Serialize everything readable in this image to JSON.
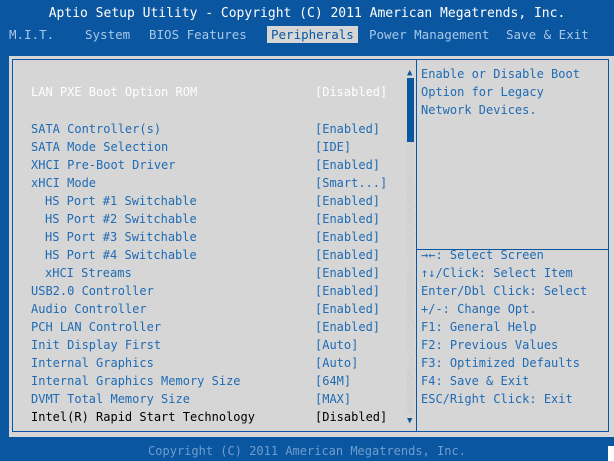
{
  "header": {
    "title": "Aptio Setup Utility - Copyright (C) 2011 American Megatrends, Inc."
  },
  "tabs": [
    {
      "label": "M.I.T."
    },
    {
      "label": "System"
    },
    {
      "label": "BIOS Features"
    },
    {
      "label": "Peripherals",
      "active": true
    },
    {
      "label": "Power Management"
    },
    {
      "label": "Save & Exit"
    }
  ],
  "settings": [
    {
      "label": "LAN PXE Boot Option ROM",
      "value": "[Disabled]"
    },
    {
      "label": "SATA Controller(s)",
      "value": "[Enabled]"
    },
    {
      "label": "SATA Mode Selection",
      "value": "[IDE]"
    },
    {
      "label": "XHCI Pre-Boot Driver",
      "value": "[Enabled]"
    },
    {
      "label": "xHCI Mode",
      "value": "[Smart...]"
    },
    {
      "label": "HS Port #1 Switchable",
      "value": "[Enabled]"
    },
    {
      "label": "HS Port #2 Switchable",
      "value": "[Enabled]"
    },
    {
      "label": "HS Port #3 Switchable",
      "value": "[Enabled]"
    },
    {
      "label": "HS Port #4 Switchable",
      "value": "[Enabled]"
    },
    {
      "label": "xHCI Streams",
      "value": "[Enabled]"
    },
    {
      "label": "USB2.0 Controller",
      "value": "[Enabled]"
    },
    {
      "label": "Audio Controller",
      "value": "[Enabled]"
    },
    {
      "label": "PCH LAN Controller",
      "value": "[Enabled]"
    },
    {
      "label": "Init Display First",
      "value": "[Auto]"
    },
    {
      "label": "Internal Graphics",
      "value": "[Auto]"
    },
    {
      "label": "Internal Graphics Memory Size",
      "value": "[64M]"
    },
    {
      "label": "DVMT Total Memory Size",
      "value": "[MAX]"
    },
    {
      "label": "Intel(R) Rapid Start Technology",
      "value": "[Disabled]"
    }
  ],
  "description": [
    "Enable or Disable Boot",
    "Option for Legacy",
    "Network Devices."
  ],
  "help": [
    "→←: Select Screen",
    "↑↓/Click: Select Item",
    "Enter/Dbl Click: Select",
    "+/-: Change Opt.",
    "F1: General Help",
    "F2: Previous Values",
    "F3: Optimized Defaults",
    "F4: Save & Exit",
    "ESC/Right Click: Exit"
  ],
  "footer": {
    "text": "Copyright (C) 2011 American Megatrends, Inc."
  },
  "colors": {
    "background": "#0a56a0",
    "panel": "#d6d6d6",
    "highlight_text": "#ffffff",
    "item_text": "#1f6bb4"
  }
}
